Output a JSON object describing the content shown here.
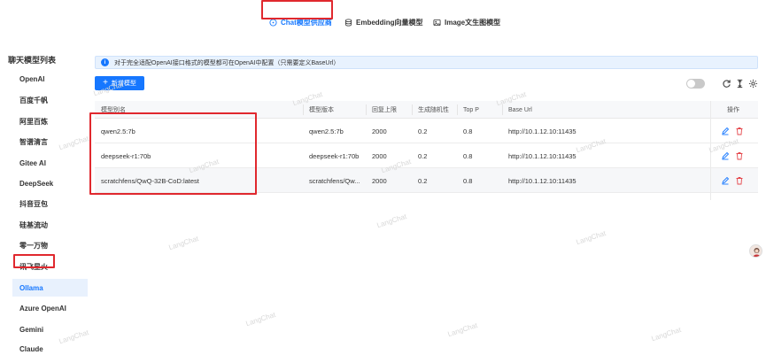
{
  "tabs": [
    {
      "label": "Chat模型供应商",
      "icon": "chat-icon"
    },
    {
      "label": "Embedding向量模型",
      "icon": "database-icon"
    },
    {
      "label": "Image文生图模型",
      "icon": "image-icon"
    }
  ],
  "sidebar": {
    "title": "聊天模型列表",
    "items": [
      "OpenAI",
      "百度千帆",
      "阿里百炼",
      "智谱清言",
      "Gitee AI",
      "DeepSeek",
      "抖音豆包",
      "硅基流动",
      "零一万物",
      "讯飞星火",
      "Ollama",
      "Azure OpenAI",
      "Gemini",
      "Claude"
    ],
    "active": "Ollama"
  },
  "info": {
    "text": "对于完全适配OpenAI接口格式的模型都可在OpenAI中配置（只需要定义BaseUrl）"
  },
  "toolbar": {
    "add_label": "新增模型"
  },
  "table": {
    "columns": [
      "模型别名",
      "模型版本",
      "回复上限",
      "生成随机性",
      "Top P",
      "Base Url",
      "操作"
    ],
    "rows": [
      [
        "qwen2.5:7b",
        "qwen2.5:7b",
        "2000",
        "0.2",
        "0.8",
        "http://10.1.12.10:11435"
      ],
      [
        "deepseek-r1:70b",
        "deepseek-r1:70b",
        "2000",
        "0.2",
        "0.8",
        "http://10.1.12.10:11435"
      ],
      [
        "scratchfens/QwQ-32B-CoD:latest",
        "scratchfens/Qw...",
        "2000",
        "0.2",
        "0.8",
        "http://10.1.12.10:11435"
      ]
    ]
  },
  "watermark": "LangChat",
  "colors": {
    "accent": "#1677ff",
    "highlight": "#e0282e",
    "danger": "#e5484d"
  }
}
